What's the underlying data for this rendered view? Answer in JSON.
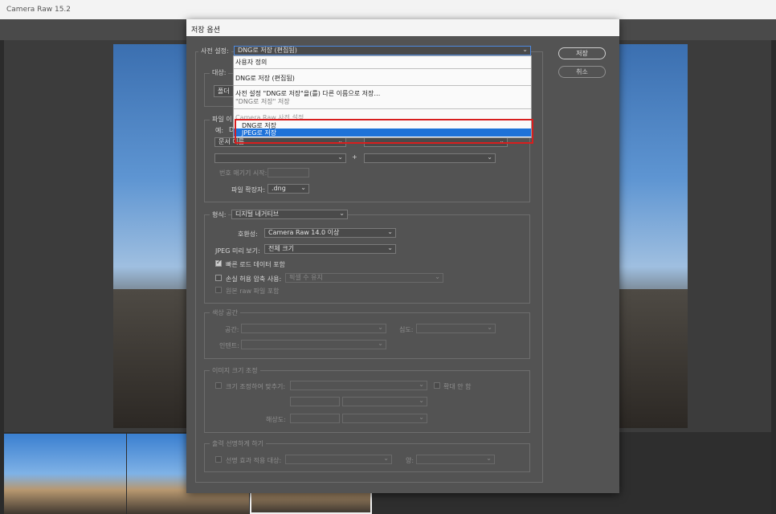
{
  "window": {
    "title": "Camera Raw 15.2"
  },
  "dialog": {
    "title": "저장 옵션",
    "save_button": "저장",
    "cancel_button": "취소"
  },
  "preset": {
    "label": "사전 설정:",
    "value": "DNG로 저장 (편집됨)",
    "menu": {
      "items": [
        {
          "label": "사용자 정의"
        },
        {
          "label": "DNG로 저장 (편집됨)"
        },
        {
          "label": "사전 설정 \"DNG로 저장\"을(를) 다른 이름으로 저장…"
        },
        {
          "label": "\"DNG로 저장\" 저장"
        }
      ],
      "section_header": "Camera Raw 사전 설정",
      "section_items": [
        {
          "label": "DNG로 저장"
        },
        {
          "label": "JPEG로 저장"
        }
      ]
    }
  },
  "destination": {
    "legend": "대상:",
    "button_partial": "폴더"
  },
  "file_naming": {
    "legend": "파일 이",
    "example_label": "예:",
    "example_value": "D",
    "field1_value": "문서 이름",
    "plus": "+",
    "begin_number_label": "번호 매기기 시작:",
    "extension_label": "파일 확장자:",
    "extension_value": ".dng"
  },
  "format": {
    "label": "형식:",
    "value": "디지털 네거티브",
    "compat_label": "호환성:",
    "compat_value": "Camera Raw 14.0 이상",
    "jpeg_preview_label": "JPEG 미리 보기:",
    "jpeg_preview_value": "전체 크기",
    "fast_load_label": "빠른 로드 데이터 포함",
    "lossy_label": "손실 허용 압축 사용:",
    "lossy_value": "픽셀 수 유지",
    "embed_raw_label": "원본 raw 파일 포함"
  },
  "color_space": {
    "legend": "색상 공간",
    "space_label": "공간:",
    "depth_label": "심도:",
    "intent_label": "인텐트:"
  },
  "image_size": {
    "legend": "이미지 크기 조정",
    "resize_label": "크기 조정하여 맞추기:",
    "no_enlarge_label": "확대 안 함",
    "resolution_label": "해상도:"
  },
  "output_sharpening": {
    "legend": "출력 선명하게 하기",
    "sharpen_label": "선명 효과 적용 대상:",
    "amount_label": "양:"
  }
}
